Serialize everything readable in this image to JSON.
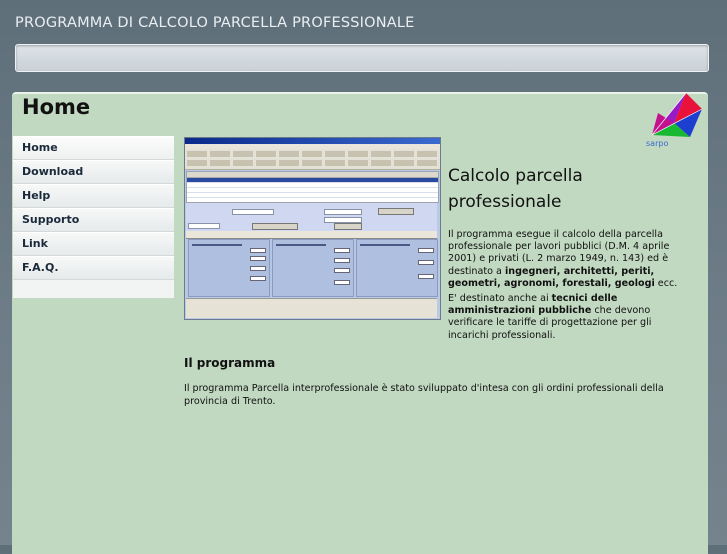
{
  "header": {
    "site_title": "PROGRAMMA DI CALCOLO PARCELLA PROFESSIONALE"
  },
  "page": {
    "heading": "Home"
  },
  "logo": {
    "icon": "kite-logo-icon",
    "text": "sarpo"
  },
  "sidebar": {
    "items": [
      {
        "label": "Home"
      },
      {
        "label": "Download"
      },
      {
        "label": "Help"
      },
      {
        "label": "Supporto"
      },
      {
        "label": "Link"
      },
      {
        "label": "F.A.Q."
      }
    ]
  },
  "article": {
    "title": "Calcolo parcella professionale",
    "intro_1": "Il programma esegue il calcolo della parcella professionale per lavori pubblici (D.M. 4 aprile 2001) e privati (L. 2 marzo 1949, n. 143) ed è destinato a ",
    "intro_bold": "ingegneri, architetti, periti, geometri, agronomi, forestali, geologi",
    "intro_2": " ecc.",
    "target_1": "E' destinato anche ai ",
    "target_bold": "tecnici delle amministrazioni pubbliche",
    "target_2": " che devono verificare le tariffe di progettazione per gli incarichi professionali."
  },
  "program_section": {
    "heading": "Il programma",
    "text": "Il programma Parcella interprofessionale è stato sviluppato d'intesa con gli ordini professionali della provincia di Trento."
  },
  "colors": {
    "background": "#6e7d87",
    "content_panel": "#c1d8c1",
    "sidebar": "#f2f4f4"
  }
}
